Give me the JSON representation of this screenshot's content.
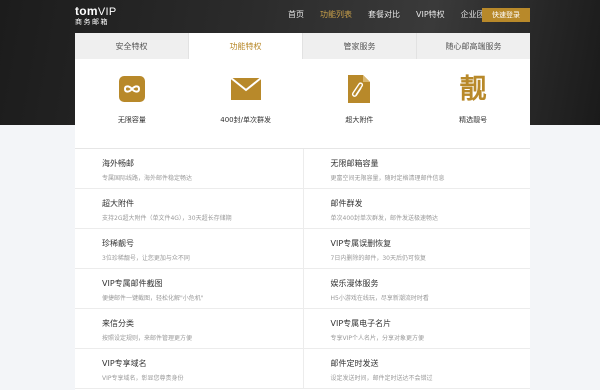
{
  "logo": {
    "main": "tom",
    "vip": "VIP",
    "sub": "商务邮箱"
  },
  "nav": {
    "items": [
      "首页",
      "功能列表",
      "套餐对比",
      "VIP特权",
      "企业团购"
    ],
    "active_index": 1,
    "cta": "快速登录"
  },
  "tabs": {
    "items": [
      "安全特权",
      "功能特权",
      "管家服务",
      "随心邮高端服务"
    ],
    "active_index": 1
  },
  "features": [
    {
      "label": "无限容量",
      "icon": "infinity-icon"
    },
    {
      "label": "400封/单次群发",
      "icon": "envelope-icon"
    },
    {
      "label": "超大附件",
      "icon": "paperclip-file-icon"
    },
    {
      "label": "精选靓号",
      "icon": "liang-character-icon"
    }
  ],
  "feature_glyph": "靓",
  "list": [
    {
      "title": "海外畅邮",
      "desc": "专属国际线路，海外邮件稳定畅达"
    },
    {
      "title": "无限邮箱容量",
      "desc": "更富空间无限容量，随时定格清理邮件信息"
    },
    {
      "title": "超大附件",
      "desc": "支持2G超大附件（单文件4G），30天超长存储期"
    },
    {
      "title": "邮件群发",
      "desc": "单次400封单次群发，邮件发送极速畅达"
    },
    {
      "title": "珍稀靓号",
      "desc": "3位珍稀靓号，让您更加与众不同"
    },
    {
      "title": "VIP专属误删恢复",
      "desc": "7日内删除的邮件，30天后仍可恢复"
    },
    {
      "title": "VIP专属邮件截图",
      "desc": "便捷邮件一键截图，轻松化解\"小危机\""
    },
    {
      "title": "娱乐漫体服务",
      "desc": "H5小游戏在线玩，尽享新潮流时时看"
    },
    {
      "title": "来信分类",
      "desc": "按照设定规则，来邮件管理更方便"
    },
    {
      "title": "VIP专属电子名片",
      "desc": "专享VIP个人名片，分享对象更方便"
    },
    {
      "title": "VIP专享域名",
      "desc": "VIP专享域名，彰显您尊贵身份"
    },
    {
      "title": "邮件定时发送",
      "desc": "设定发送时间，邮件定时送达不会错过"
    }
  ],
  "colors": {
    "accent": "#b8892a",
    "hero_dark": "#2b2b2b"
  }
}
